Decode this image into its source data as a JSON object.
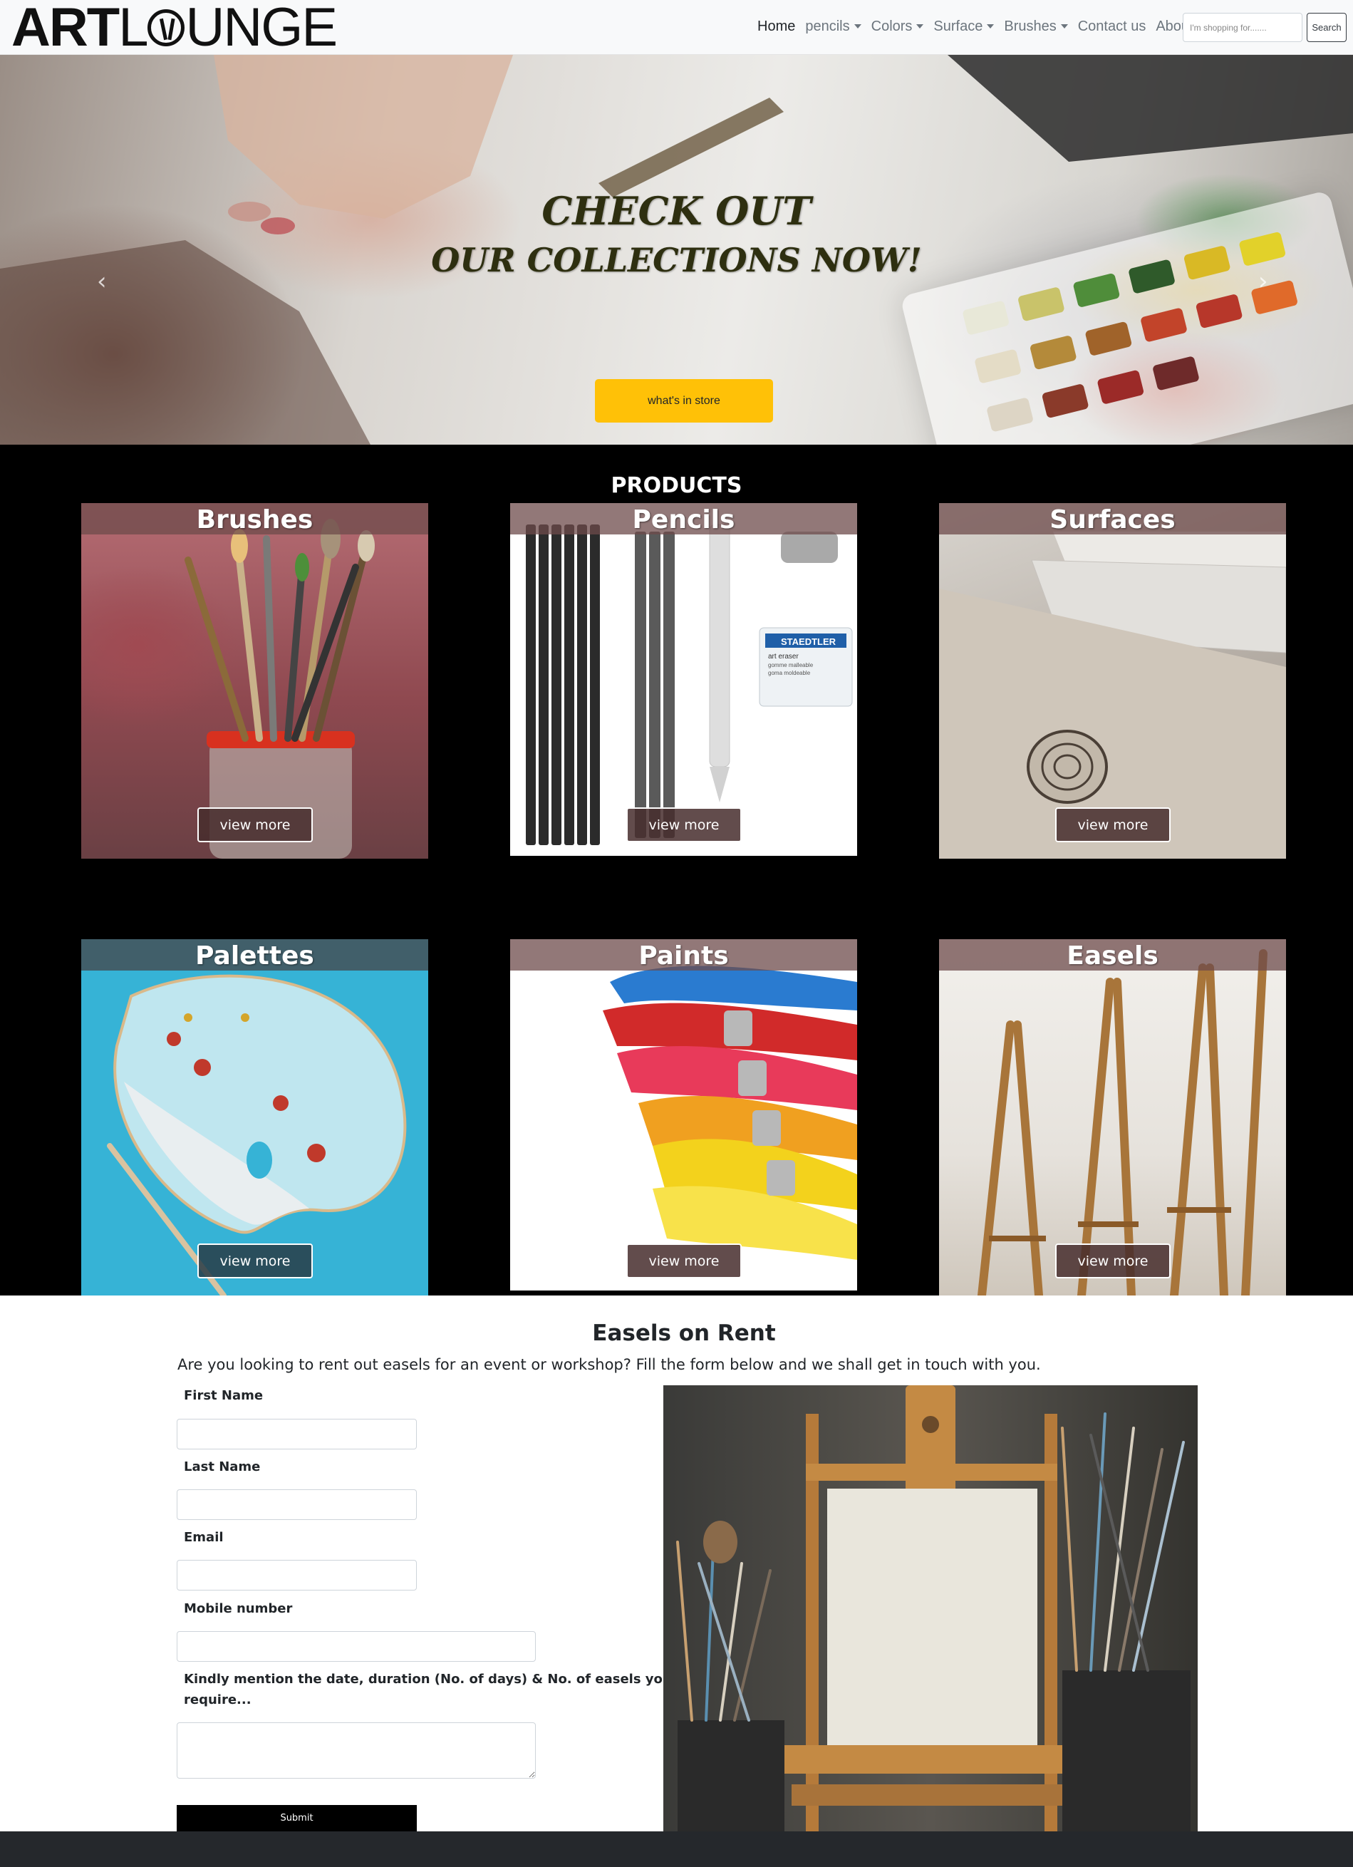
{
  "navbar": {
    "logo_art": "ART",
    "logo_lounge_l": "L",
    "logo_lounge_rest": "UNGE",
    "links": [
      {
        "label": "Home",
        "dropdown": false,
        "active": true
      },
      {
        "label": "pencils",
        "dropdown": true,
        "active": false
      },
      {
        "label": "Colors",
        "dropdown": true,
        "active": false
      },
      {
        "label": "Surface",
        "dropdown": true,
        "active": false
      },
      {
        "label": "Brushes",
        "dropdown": true,
        "active": false
      },
      {
        "label": "Contact us",
        "dropdown": false,
        "active": false
      },
      {
        "label": "About",
        "dropdown": false,
        "active": false
      }
    ],
    "search_placeholder": "I'm shopping for.......",
    "search_button": "Search"
  },
  "hero": {
    "title_line1": "CHECK OUT",
    "title_line2": "OUR COLLECTIONS NOW!",
    "cta_label": "what's in store",
    "cta_color": "#ffc107",
    "prev_icon": "chevron-left-icon",
    "next_icon": "chevron-right-icon"
  },
  "products": {
    "heading": "PRODUCTS",
    "view_more_label": "view more",
    "items": [
      {
        "title": "Brushes"
      },
      {
        "title": "Pencils"
      },
      {
        "title": "Surfaces"
      },
      {
        "title": "Palettes"
      },
      {
        "title": "Paints"
      },
      {
        "title": "Easels"
      }
    ]
  },
  "rent_form": {
    "heading": "Easels on Rent",
    "intro": "Are you looking to rent out easels for an event or workshop? Fill the form below and we shall get in touch with you.",
    "first_name_label": "First Name",
    "last_name_label": "Last Name",
    "email_label": "Email",
    "mobile_label": "Mobile number",
    "details_label_line1": "Kindly mention the date, duration (No. of days) & No. of easels you",
    "details_label_line2": "require...",
    "submit_label": "Submit"
  },
  "pencil_card": {
    "brand": "STAEDTLER",
    "eraser_line1": "art eraser",
    "eraser_line2": "gomme malleable",
    "eraser_line3": "goma moldeable"
  }
}
